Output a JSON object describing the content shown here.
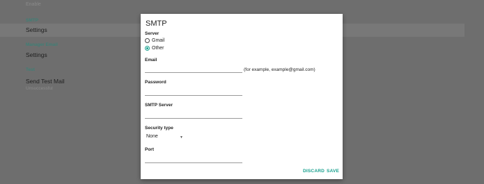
{
  "background": {
    "top_cut_text": "Enable",
    "sections": [
      {
        "header": "SMTP",
        "row": "Settings",
        "highlighted": true
      },
      {
        "header": "Manager Email",
        "row": "Settings",
        "highlighted": false
      },
      {
        "header": "Test",
        "row": "Send Test Mail",
        "sub": "Unsuccessful",
        "highlighted": false
      }
    ]
  },
  "dialog": {
    "title": "SMTP",
    "server_label": "Server",
    "server_options": [
      {
        "label": "Gmail",
        "selected": false
      },
      {
        "label": "Other",
        "selected": true
      }
    ],
    "email_label": "Email",
    "email_value": "",
    "email_hint": "(for example, example@gmail.com)",
    "password_label": "Password",
    "password_value": "",
    "smtp_server_label": "SMTP Server",
    "smtp_server_value": "",
    "security_label": "Security type",
    "security_value": "None",
    "port_label": "Port",
    "port_value": "",
    "discard_label": "DISCARD",
    "save_label": "SAVE"
  },
  "colors": {
    "accent": "#17a08e",
    "section_header": "#3f7f76",
    "overlay": "#6e6e6e"
  }
}
